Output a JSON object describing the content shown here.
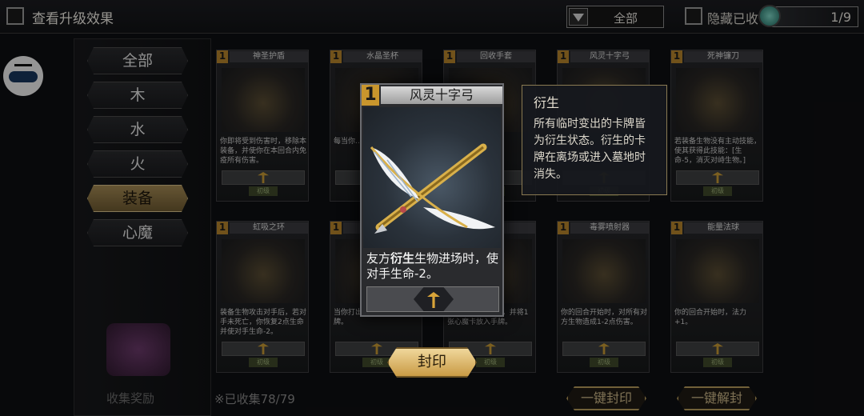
{
  "header": {
    "title": "查看升级效果",
    "filter_value": "全部",
    "hide_label": "隐藏已收",
    "page": "1/9"
  },
  "sidebar": {
    "categories": [
      "全部",
      "木",
      "水",
      "火",
      "装备",
      "心魔"
    ],
    "active": "装备",
    "collect_reward": "收集奖励"
  },
  "cards": [
    {
      "cost": "1",
      "name": "神圣护盾",
      "desc": "你即将受到伤害时，移除本装备，并使你在本回合内免疫所有伤害。",
      "tag": "初级"
    },
    {
      "cost": "1",
      "name": "水晶圣杯",
      "desc": "每当你…，法力…多生效…",
      "tag": "初级"
    },
    {
      "cost": "1",
      "name": "回收手套",
      "desc": "…2，且…所有…",
      "tag": "初级"
    },
    {
      "cost": "1",
      "name": "风灵十字弓",
      "desc": "",
      "tag": "初级"
    },
    {
      "cost": "1",
      "name": "死神镰刀",
      "desc": "若装备生物没有主动技能，使其获得此技能：[生命-5，消灭对峙生物。]",
      "tag": "初级"
    },
    {
      "cost": "1",
      "name": "虹吸之环",
      "desc": "装备生物攻击对手后，若对手未死亡，你恢复2点生命并使对手生命-2。",
      "tag": "初级"
    },
    {
      "cost": "1",
      "name": "",
      "desc": "当你打出装备卡时，抽1张牌。",
      "tag": "初级"
    },
    {
      "cost": "1",
      "name": "",
      "desc": "为你恢复3点生命，并将1张心魔卡放入手牌。",
      "tag": "初级"
    },
    {
      "cost": "1",
      "name": "毒雾喷射器",
      "desc": "你的回合开始时，对所有对方生物造成1-2点伤害。",
      "tag": "初级"
    },
    {
      "cost": "1",
      "name": "能量法球",
      "desc": "你的回合开始时，法力+1。",
      "tag": "初级"
    }
  ],
  "featured": {
    "cost": "1",
    "name": "风灵十字弓",
    "desc_prefix": "友方",
    "desc_keyword": "衍生",
    "desc_suffix": "生物进场时，使对手生命-2。"
  },
  "tooltip": {
    "title": "衍生",
    "body": "所有临时变出的卡牌皆为衍生状态。衍生的卡牌在离场或进入墓地时消失。"
  },
  "footer": {
    "collected": "※已收集78/79",
    "seal_button": "封印",
    "seal_all_button": "一键封印",
    "unseal_all_button": "一键解封"
  }
}
